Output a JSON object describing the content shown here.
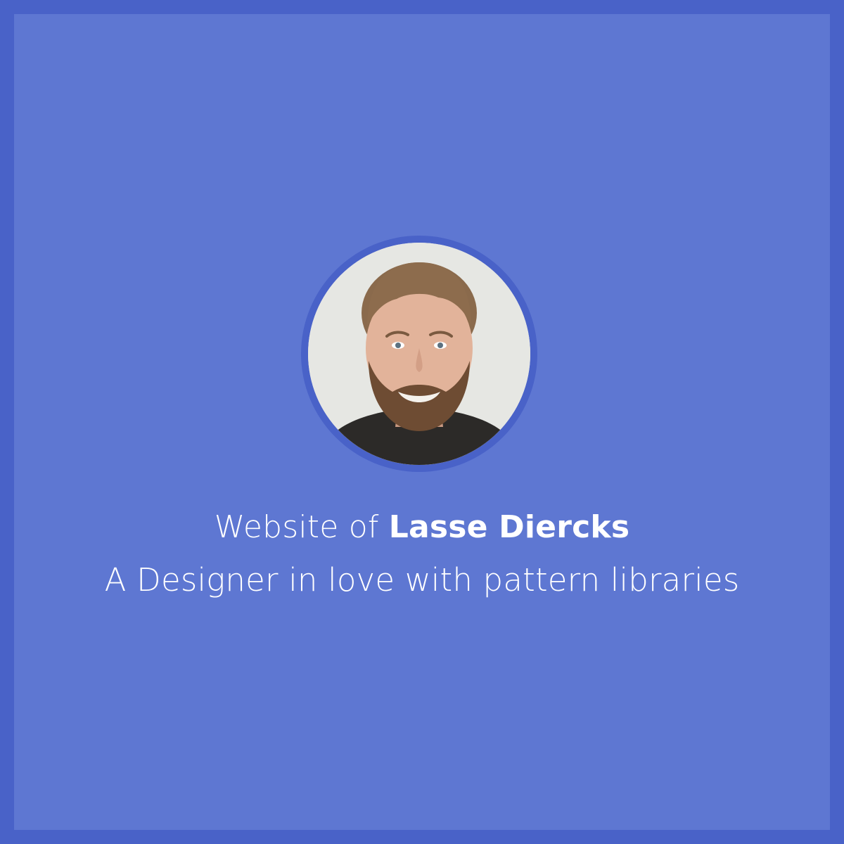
{
  "intro": {
    "prefix": "Website of ",
    "name": "Lasse Diercks"
  },
  "tagline": "A Designer in love with pattern libraries",
  "colors": {
    "border": "#4962c8",
    "background": "#5e77d2",
    "text": "#ffffff"
  },
  "avatar": {
    "icon": "portrait-photo"
  }
}
